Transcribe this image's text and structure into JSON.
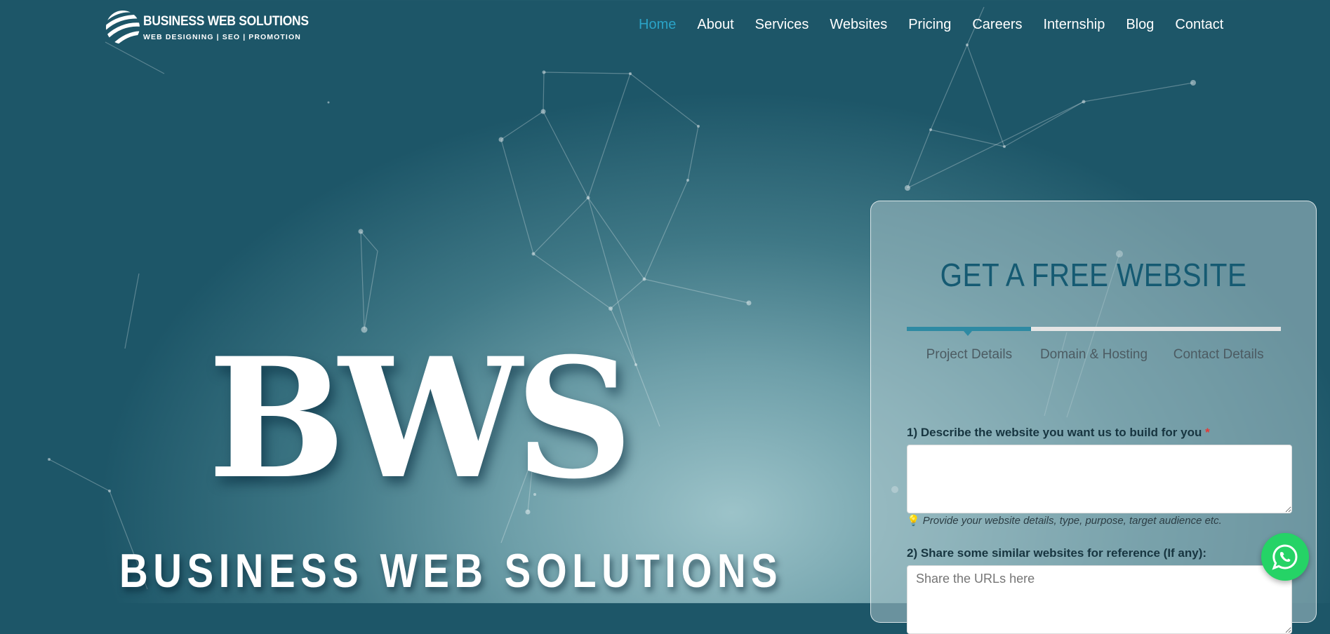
{
  "header": {
    "logo": {
      "title": "BUSINESS WEB SOLUTIONS",
      "tagline": "WEB DESIGNING | SEO | PROMOTION"
    },
    "nav": [
      {
        "label": "Home",
        "active": true
      },
      {
        "label": "About"
      },
      {
        "label": "Services"
      },
      {
        "label": "Websites"
      },
      {
        "label": "Pricing"
      },
      {
        "label": "Careers"
      },
      {
        "label": "Internship"
      },
      {
        "label": "Blog"
      },
      {
        "label": "Contact"
      }
    ]
  },
  "hero": {
    "bws": "BWS",
    "subtitle": "BUSINESS WEB SOLUTIONS"
  },
  "form": {
    "title": "GET A FREE WEBSITE",
    "progress_fraction": 0.333,
    "steps": [
      {
        "label": "Project Details"
      },
      {
        "label": "Domain & Hosting"
      },
      {
        "label": "Contact Details"
      }
    ],
    "q1": {
      "label": "1) Describe the website you want us to build for you",
      "required_mark": "*",
      "value": "",
      "hint": "Provide your website details, type, purpose, target audience etc.",
      "hint_icon": "💡"
    },
    "q2": {
      "label": "2) Share some similar websites for reference (If any):",
      "placeholder": "Share the URLs here"
    }
  },
  "colors": {
    "nav_active": "#2aa3c7",
    "form_title": "#155a72",
    "progress": "#2e8aa3",
    "whatsapp": "#25d366"
  },
  "icons": {
    "logo": "globe-stripes-icon",
    "whatsapp": "whatsapp-icon"
  }
}
